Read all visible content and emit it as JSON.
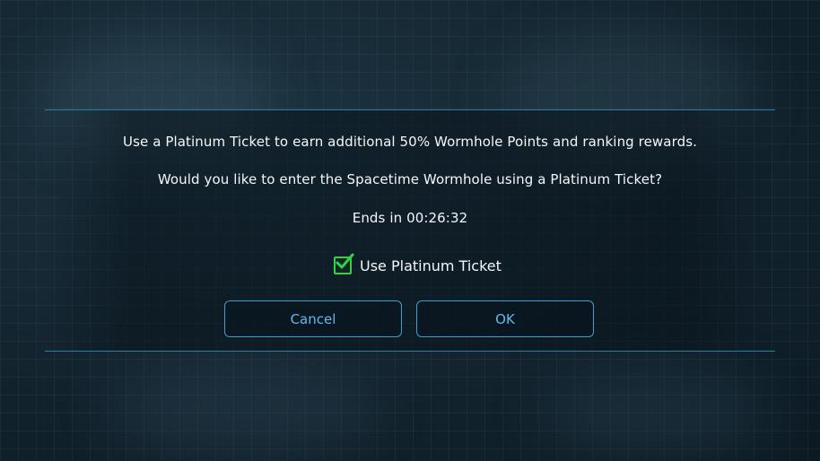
{
  "dialog": {
    "message_line1": "Use a Platinum Ticket to earn additional 50% Wormhole Points and ranking rewards.",
    "message_line2": "Would you like to enter the Spacetime Wormhole using a Platinum Ticket?",
    "timer_text": "Ends in 00:26:32",
    "checkbox": {
      "label": "Use Platinum Ticket",
      "checked": true
    },
    "buttons": {
      "cancel_label": "Cancel",
      "ok_label": "OK"
    }
  },
  "colors": {
    "accent": "#3d9ed0",
    "button_text": "#64b8ee",
    "checkbox": "#35d147"
  },
  "icons": {
    "checkbox_icon": "check-icon"
  }
}
